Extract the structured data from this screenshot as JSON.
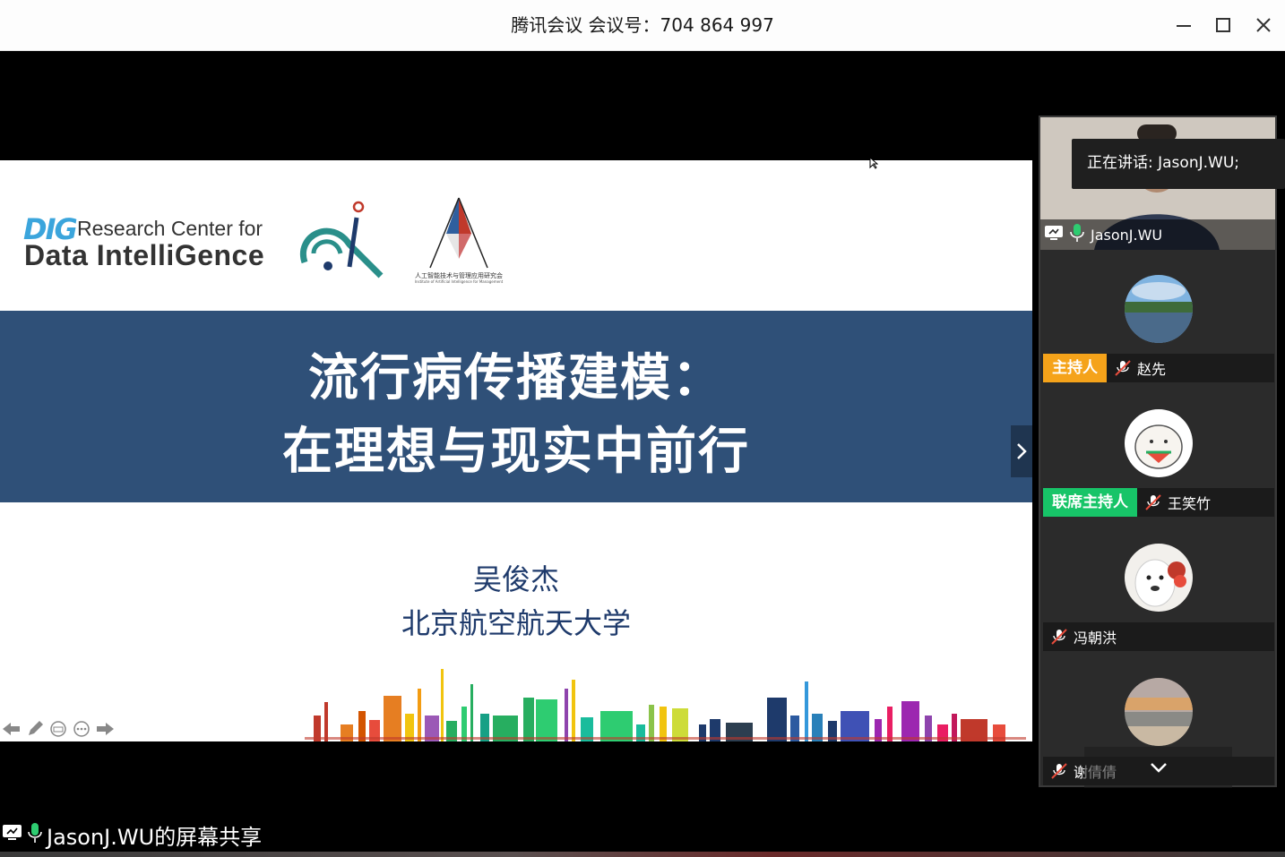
{
  "window": {
    "title": "腾讯会议 会议号：704 864 997"
  },
  "slide": {
    "logo_line1": "Research Center for",
    "logo_line2": "Data IntelliGence",
    "logo_mark": "DIG",
    "institute_caption": "人工智能技术与管理应用研究会",
    "institute_caption_en": "Institute of Artificial Intelligence for Management",
    "title_line1": "流行病传播建模：",
    "title_line2": "在理想与现实中前行",
    "author": "吴俊杰",
    "affiliation": "北京航空航天大学",
    "colors": {
      "banner": "#2f5078",
      "text_navy": "#1e3a6b"
    }
  },
  "speaker": {
    "name": "JasonJ.WU",
    "tooltip": "正在讲话: JasonJ.WU;"
  },
  "participants": [
    {
      "name": "赵先",
      "role": "主持人",
      "role_color": "#f5a31a",
      "muted": true
    },
    {
      "name": "王笑竹",
      "role": "联席主持人",
      "role_color": "#17c468",
      "muted": true
    },
    {
      "name": "冯朝洪",
      "role": "",
      "muted": true
    },
    {
      "name": "谢倩倩",
      "role": "",
      "muted": true
    }
  ],
  "share_label": "JasonJ.WU的屏幕共享",
  "icons": [
    "minimize-icon",
    "maximize-icon",
    "close-icon",
    "chevron-right-icon",
    "chevron-down-icon",
    "mic-icon",
    "mic-muted-icon",
    "screen-share-icon",
    "arrow-left-icon",
    "pen-icon",
    "subtitle-icon",
    "more-icon",
    "arrow-right-icon"
  ]
}
